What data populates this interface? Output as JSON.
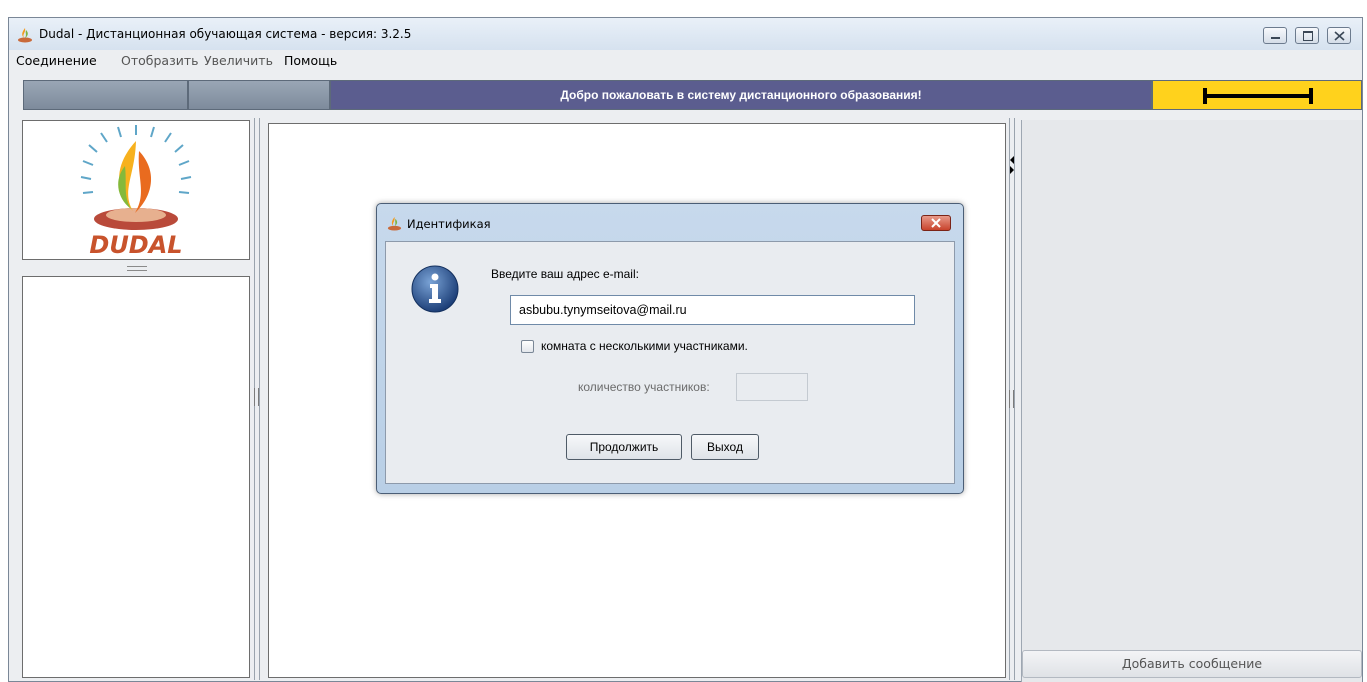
{
  "window": {
    "title": "Dudal - Дистанционная обучающая система - версия: 3.2.5"
  },
  "menu": {
    "items": [
      {
        "label": "Соединение"
      },
      {
        "label": "Отобразить"
      },
      {
        "label": "Увеличить"
      },
      {
        "label": "Помощь"
      }
    ]
  },
  "toolbar": {
    "welcome": "Добро пожаловать в систему дистанционного образования!"
  },
  "logo": {
    "text": "DUDAL"
  },
  "dialog": {
    "title": "Идентификая",
    "prompt": "Введите ваш адрес e-mail:",
    "email_value": "asbubu.tynymseitova@mail.ru",
    "multi_room_label": "комната с несколькими участниками.",
    "multi_room_checked": false,
    "participants_label": "количество участников:",
    "participants_value": "",
    "continue_label": "Продолжить",
    "exit_label": "Выход"
  },
  "right_panel": {
    "add_message_label": "Добавить сообщение"
  },
  "colors": {
    "welcome_bar": "#5b5d8f",
    "indicator": "#ffd21c",
    "dialog_frame": "#bed3e8"
  },
  "icons": {
    "app": "dudal-flame-icon",
    "info": "info-icon",
    "close": "close-icon",
    "progress": "progress-indicator-icon"
  }
}
